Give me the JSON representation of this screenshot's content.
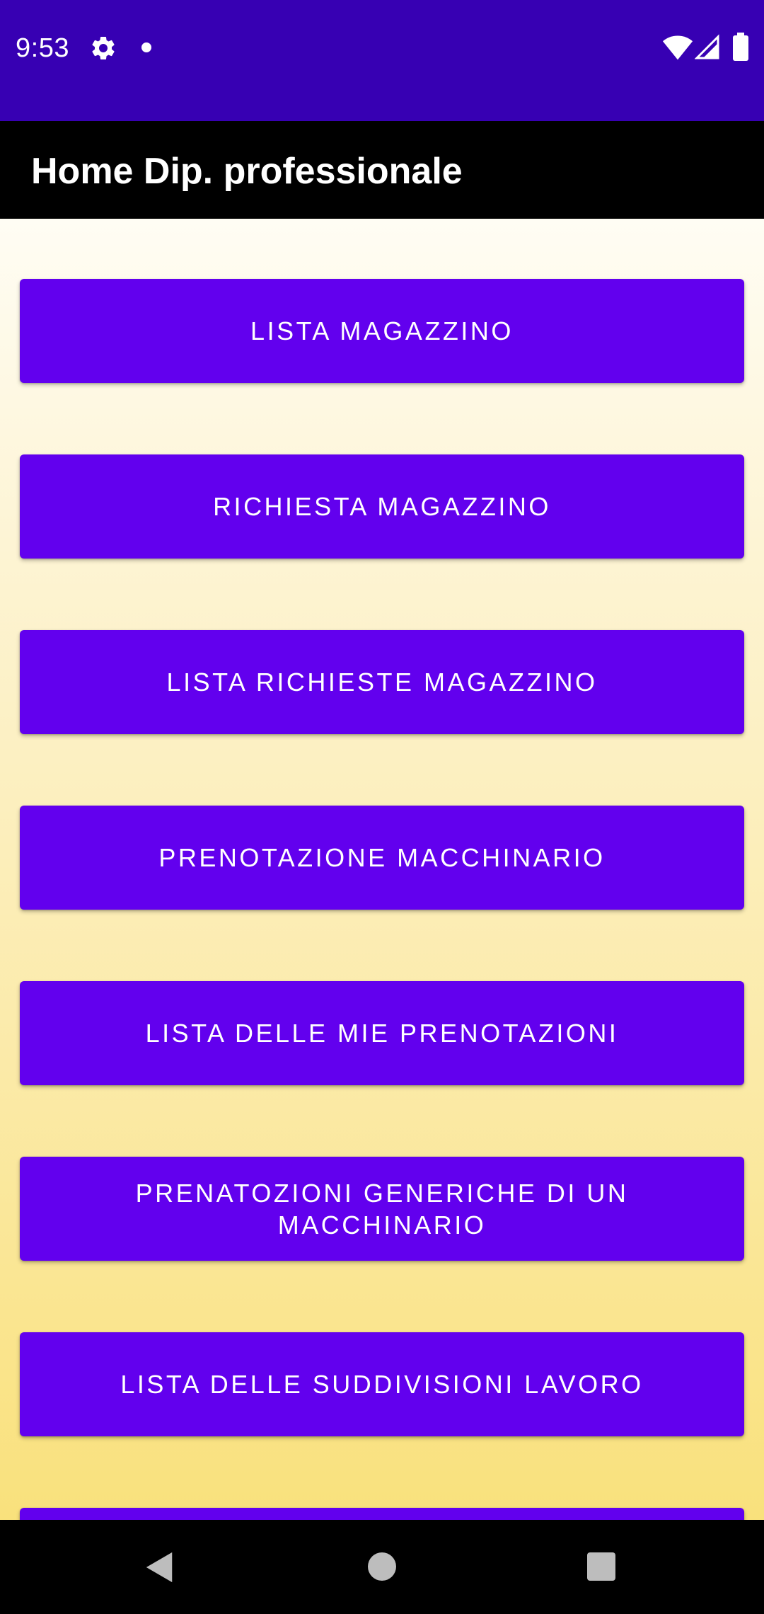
{
  "status_bar": {
    "time": "9:53",
    "icons": [
      "gear-icon",
      "notification-dot-icon",
      "wifi-icon",
      "cell-signal-icon",
      "battery-icon"
    ],
    "background": "#3700b3"
  },
  "app_bar": {
    "title": "Home Dip. professionale",
    "background": "#000000"
  },
  "menu": {
    "button_color": "#6200ee",
    "buttons": [
      {
        "label": "LISTA MAGAZZINO"
      },
      {
        "label": "RICHIESTA MAGAZZINO"
      },
      {
        "label": "LISTA RICHIESTE MAGAZZINO"
      },
      {
        "label": "PRENOTAZIONE MACCHINARIO"
      },
      {
        "label": "LISTA DELLE MIE PRENOTAZIONI"
      },
      {
        "label": "PRENATOZIONI GENERICHE DI UN MACCHINARIO"
      },
      {
        "label": "LISTA DELLE SUDDIVISIONI LAVORO"
      },
      {
        "label": ""
      }
    ]
  },
  "nav_bar": {
    "icons": [
      "back-icon",
      "home-icon",
      "recent-apps-icon"
    ]
  }
}
